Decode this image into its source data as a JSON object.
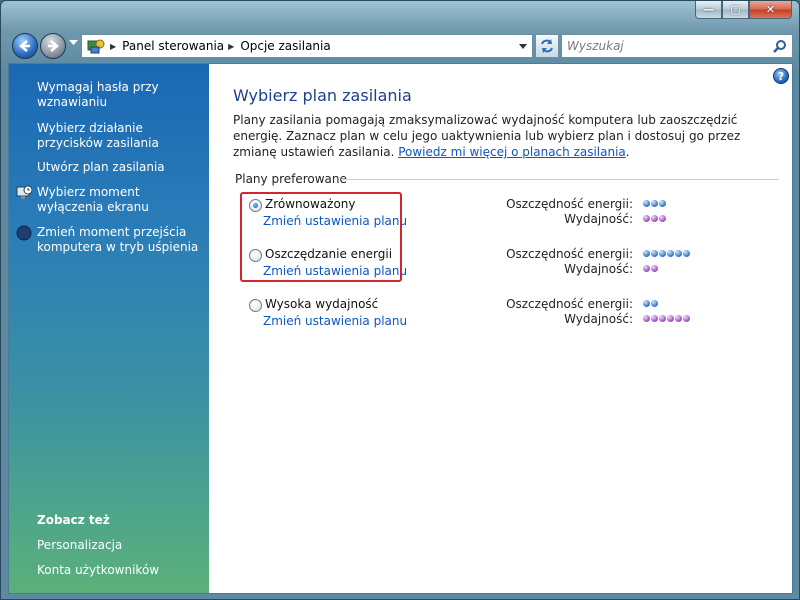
{
  "window": {
    "minimize_label": "—",
    "maximize_label": "▢",
    "close_label": "✕"
  },
  "address_bar": {
    "crumbs": [
      "Panel sterowania",
      "Opcje zasilania"
    ],
    "search_placeholder": "Wyszukaj"
  },
  "sidebar": {
    "tasks": [
      {
        "label": "Wymagaj hasła przy wznawianiu",
        "icon": "none"
      },
      {
        "label": "Wybierz działanie przycisków zasilania",
        "icon": "none"
      },
      {
        "label": "Utwórz plan zasilania",
        "icon": "none"
      },
      {
        "label": "Wybierz moment wyłączenia ekranu",
        "icon": "monitor-clock-icon"
      },
      {
        "label": "Zmień moment przejścia komputera w tryb uśpienia",
        "icon": "moon-icon"
      }
    ],
    "see_also_title": "Zobacz też",
    "see_also": [
      "Personalizacja",
      "Konta użytkowników"
    ]
  },
  "main": {
    "title": "Wybierz plan zasilania",
    "description": "Plany zasilania pomagają zmaksymalizować wydajność komputera lub zaoszczędzić energię. Zaznacz plan w celu jego uaktywnienia lub wybierz plan i dostosuj go przez zmianę ustawień zasilania.",
    "description_link": "Powiedz mi więcej o planach zasilania",
    "description_end": ".",
    "group_title": "Plany preferowane",
    "energy_label": "Oszczędność energii:",
    "performance_label": "Wydajność:",
    "plans": [
      {
        "name": "Zrównoważony",
        "link": "Zmień ustawienia planu",
        "selected": true,
        "energy": 3,
        "performance": 3
      },
      {
        "name": "Oszczędzanie energii",
        "link": "Zmień ustawienia planu",
        "selected": false,
        "energy": 6,
        "performance": 2
      },
      {
        "name": "Wysoka wydajność",
        "link": "Zmień ustawienia planu",
        "selected": false,
        "energy": 2,
        "performance": 6
      }
    ]
  },
  "colors": {
    "accent_link": "#0b56c4",
    "highlight_box": "#d0262f",
    "title": "#1e3f8a"
  }
}
